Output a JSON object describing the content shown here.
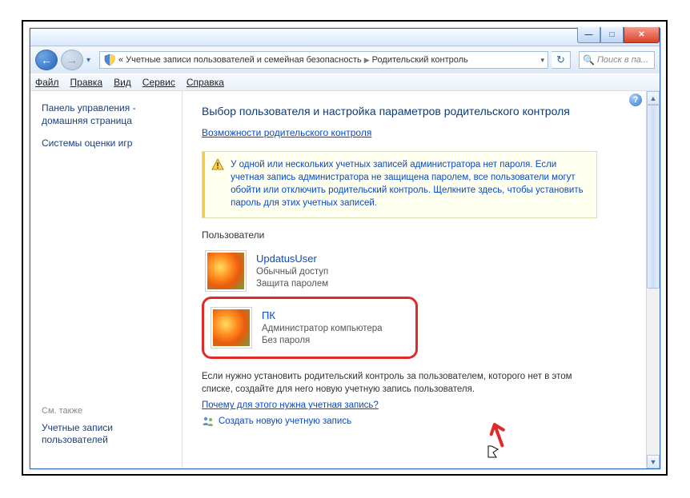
{
  "titlebar": {
    "min": "—",
    "max": "□",
    "close": "✕"
  },
  "nav": {
    "back": "←",
    "forward": "→",
    "crumb1": "«",
    "crumb2": "Учетные записи пользователей и семейная безопасность",
    "crumb3": "Родительский контроль",
    "search_placeholder": "Поиск в па...",
    "refresh": "↻"
  },
  "menubar": {
    "file": "Файл",
    "edit": "Правка",
    "view": "Вид",
    "tools": "Сервис",
    "help": "Справка"
  },
  "sidebar": {
    "home": "Панель управления - домашняя страница",
    "ratings": "Системы оценки игр",
    "see_also": "См. также",
    "user_accounts": "Учетные записи пользователей"
  },
  "content": {
    "heading": "Выбор пользователя и настройка параметров родительского контроля",
    "cap_link": "Возможности родительского контроля",
    "warning": "У одной или нескольких учетных записей администратора нет пароля. Если учетная запись администратора не защищена паролем, все пользователи могут обойти или отключить родительский контроль. Щелкните здесь, чтобы установить пароль для этих учетных записей.",
    "users_label": "Пользователи",
    "users": [
      {
        "name": "UpdatusUser",
        "line1": "Обычный доступ",
        "line2": "Защита паролем"
      },
      {
        "name": "ПК",
        "line1": "Администратор компьютера",
        "line2": "Без пароля"
      }
    ],
    "footer_text": "Если нужно установить родительский контроль за пользователем, которого нет в этом списке, создайте для него новую учетную запись пользователя.",
    "why_link": "Почему для этого нужна учетная запись?",
    "create_link": "Создать новую учетную запись"
  },
  "help": "?"
}
